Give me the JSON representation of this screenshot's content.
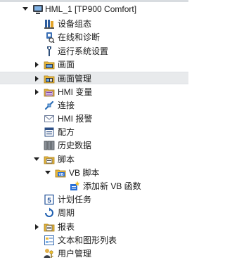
{
  "tree": {
    "root": {
      "label": "HML_1 [TP900 Comfort]",
      "expanded": true,
      "icon": "hmi-device-icon"
    },
    "items": [
      {
        "label": "设备组态",
        "icon": "device-config-icon"
      },
      {
        "label": "在线和诊断",
        "icon": "online-diagnostics-icon"
      },
      {
        "label": "运行系统设置",
        "icon": "runtime-settings-icon"
      },
      {
        "label": "画面",
        "icon": "folder-screens-icon",
        "expandable": true
      },
      {
        "label": "画面管理",
        "icon": "screen-management-icon",
        "expandable": true,
        "hover": true
      },
      {
        "label": "HMI 变量",
        "icon": "hmi-tags-icon",
        "expandable": true
      },
      {
        "label": "连接",
        "icon": "connections-icon"
      },
      {
        "label": "HMI 报警",
        "icon": "hmi-alarms-icon"
      },
      {
        "label": "配方",
        "icon": "recipes-icon"
      },
      {
        "label": "历史数据",
        "icon": "historical-data-icon"
      },
      {
        "label": "脚本",
        "icon": "folder-scripts-icon",
        "expanded": true
      },
      {
        "label": "VB 脚本",
        "icon": "vb-folder-icon",
        "expanded": true
      },
      {
        "label": "添加新 VB 函数",
        "icon": "add-vb-function-icon"
      },
      {
        "label": "计划任务",
        "icon": "scheduled-tasks-icon"
      },
      {
        "label": "周期",
        "icon": "cycles-icon"
      },
      {
        "label": "报表",
        "icon": "reports-icon",
        "expandable": true
      },
      {
        "label": "文本和图形列表",
        "icon": "text-graphic-lists-icon"
      },
      {
        "label": "用户管理",
        "icon": "user-admin-icon"
      }
    ]
  },
  "colors": {
    "hover_row": "#e8eaec",
    "folder": "#e8b83c",
    "accent_blue": "#1f5fb0",
    "vb_badge": "#2a6fd6"
  }
}
